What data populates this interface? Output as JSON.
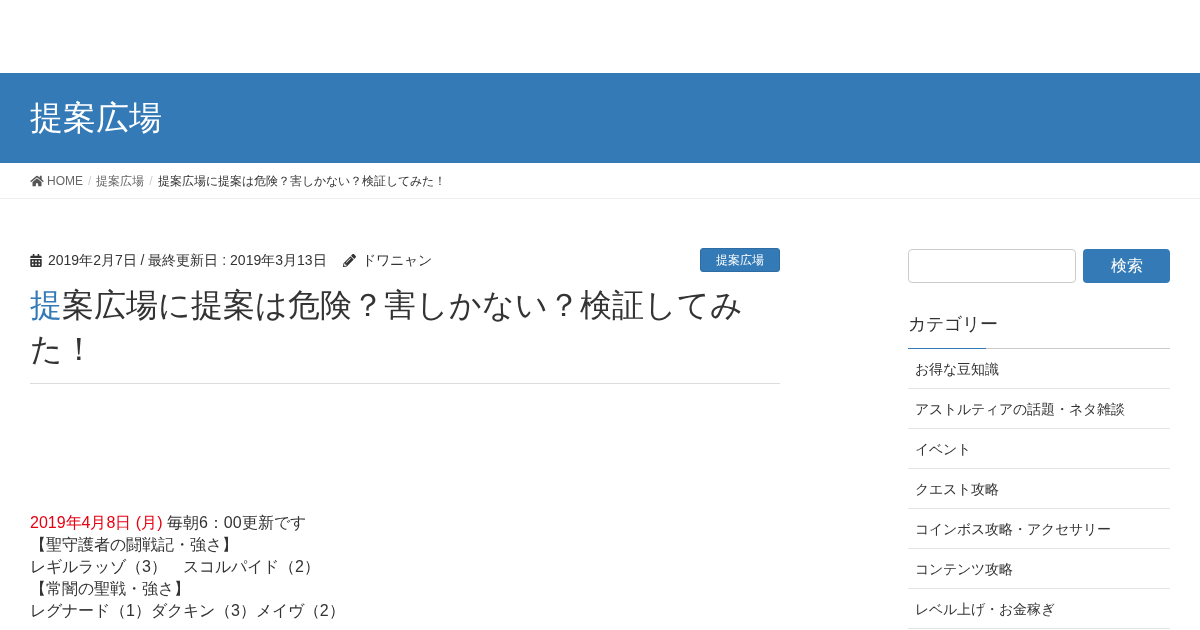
{
  "header": {
    "title": "提案広場"
  },
  "breadcrumb_separator": "/",
  "breadcrumb": [
    {
      "label": "HOME",
      "kind": "home"
    },
    {
      "label": "提案広場",
      "kind": "link"
    },
    {
      "label": "提案広場に提案は危険？害しかない？検証してみた！",
      "kind": "current"
    }
  ],
  "post": {
    "date": "2019年2月7日 / 最終更新日 : 2019年3月13日",
    "author": "ドワニャン",
    "category": "提案広場",
    "title_accent": "提",
    "title_rest": "案広場に提案は危険？害しかない？検証してみた！",
    "body": [
      {
        "highlight": "2019年4月8日 (月)",
        "text": "毎朝6：00更新です"
      },
      {
        "text": "【聖守護者の闘戦記・強さ】"
      },
      {
        "text": "レギルラッゾ（3）　スコルパイド（2）"
      },
      {
        "text": "【常闇の聖戦・強さ】"
      },
      {
        "text": "レグナード（1）ダクキン（3）メイヴ（2）"
      }
    ]
  },
  "sidebar": {
    "search_button": "検索",
    "categories_title": "カテゴリー",
    "categories": [
      "お得な豆知識",
      "アストルティアの話題・ネタ雑談",
      "イベント",
      "クエスト攻略",
      "コインボス攻略・アクセサリー",
      "コンテンツ攻略",
      "レベル上げ・お金稼ぎ"
    ]
  }
}
